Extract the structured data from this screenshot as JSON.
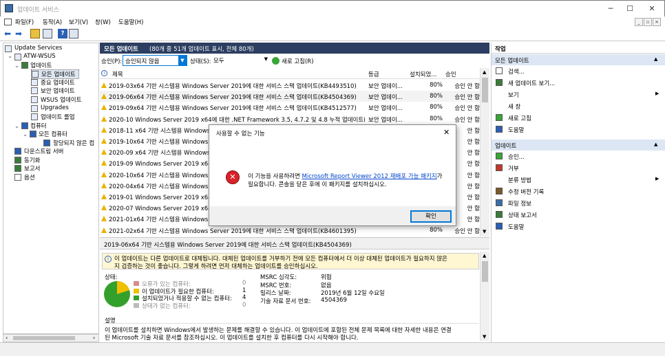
{
  "window": {
    "title": "업데이트 서비스",
    "min": "─",
    "max": "☐",
    "close": "✕",
    "mdi_min": "_",
    "mdi_restore": "▫",
    "mdi_close": "×"
  },
  "menu": [
    "파일(F)",
    "동작(A)",
    "보기(V)",
    "창(W)",
    "도움말(H)"
  ],
  "tree": {
    "root": "Update Services",
    "server": "ATW-WSUS",
    "updates": "업데이트",
    "children": [
      "모든 업데이트",
      "중요 업데이트",
      "보안 업데이트",
      "WSUS 업데이트",
      "Upgrades",
      "업데이트 롤업"
    ],
    "computers": "컴퓨터",
    "all_computers": "모든 컴퓨터",
    "unassigned": "할당되지 않은 컴",
    "downstream": "다운스트림 서버",
    "sync": "동기화",
    "reports": "보고서",
    "options": "옵션"
  },
  "header": {
    "title": "모든 업데이트",
    "count": "(80개 중 51개 업데이트 표시, 전체 80개)"
  },
  "filter": {
    "approval_label": "승인(P):",
    "approval_value": "승인되지 않음",
    "status_label": "상태(S):",
    "status_value": "모두",
    "refresh": "새로 고침(R)"
  },
  "columns": {
    "title": "제목",
    "class": "등급",
    "installed": "설치되었...",
    "approval": "승인"
  },
  "rows": [
    {
      "title": "2019-03x64 기반 시스템용 Windows Server 2019에 대한 서비스 스택 업데이트(KB4493510)",
      "class": "보안 업데이...",
      "pct": "80%",
      "approval": "승인 안 함"
    },
    {
      "title": "2019-06x64 기반 시스템용 Windows Server 2019에 대한 서비스 스택 업데이트(KB4504369)",
      "class": "보안 업데이...",
      "pct": "80%",
      "approval": "승인 안 함"
    },
    {
      "title": "2019-09x64 기반 시스템용 Windows Server 2019에 대한 서비스 스택 업데이트(KB4512577)",
      "class": "보안 업데이...",
      "pct": "80%",
      "approval": "승인 안 함"
    },
    {
      "title": "2020-10 Windows Server 2019 x64에 대한 .NET Framework 3.5, 4.7.2 및 4.8 누적 업데이트(KB...",
      "class": "보안 업데이...",
      "pct": "80%",
      "approval": "승인 안 함"
    },
    {
      "title": "2018-11 x64 기반 시스템용 Windows",
      "class": "",
      "pct": "",
      "approval": "안 함"
    },
    {
      "title": "2019-10x64 기반 시스템용 Windows S",
      "class": "",
      "pct": "",
      "approval": "안 함"
    },
    {
      "title": "2020-09 x64 기반 시스템용 Windows",
      "class": "",
      "pct": "",
      "approval": "안 함"
    },
    {
      "title": "2019-09 Windows Server 2019 x64에",
      "class": "",
      "pct": "",
      "approval": "안 함"
    },
    {
      "title": "2020-10x64 기반 시스템용 Windows S",
      "class": "",
      "pct": "",
      "approval": "안 함"
    },
    {
      "title": "2020-04x64 기반 시스템용 Windows S",
      "class": "",
      "pct": "",
      "approval": "안 함"
    },
    {
      "title": "2019-01 Windows Server 2019 x64에",
      "class": "",
      "pct": "",
      "approval": "안 함"
    },
    {
      "title": "2020-07 Windows Server 2019 x64에",
      "class": "",
      "pct": "",
      "approval": "안 함"
    },
    {
      "title": "2021-01x64 기반 시스템용 Windows S",
      "class": "",
      "pct": "",
      "approval": "안 함"
    },
    {
      "title": "2021-02x64 기반 시스템용 Windows Server 2019에 대한 서비스 스택 업데이트(KB4601395)",
      "class": "",
      "pct": "80%",
      "approval": "승인 안 함"
    }
  ],
  "detail": {
    "title": "2019-06x64 기반 시스템용 Windows Server 2019에 대한 서비스 스택 업데이트(KB4504369)",
    "info1": "이 업데이트는 다른 업데이트로 대체됩니다. 대체된 업데이트를 거부하기 전에 모든 컴퓨터에서 더 이상 대체된 업데이트가 필요하지 않은",
    "info2": "지 검증하는 것이 좋습니다. 그렇게 하려면 먼저 대체하는 업데이트를 승인하십시오.",
    "status_label": "상태:",
    "legend": [
      {
        "label": "오류가 있는 컴퓨터:",
        "value": "0",
        "color": "#d98c8c"
      },
      {
        "label": "이 업데이트가 필요한 컴퓨터:",
        "value": "1",
        "color": "#f0c000"
      },
      {
        "label": "설치되었거나 적용할 수 없는 컴퓨터:",
        "value": "4",
        "color": "#33a02c"
      },
      {
        "label": "상태가 없는 컴퓨터:",
        "value": "0",
        "color": "#bbbbbb"
      }
    ],
    "props": [
      {
        "k": "MSRC 심각도:",
        "v": "위험"
      },
      {
        "k": "MSRC 번호:",
        "v": "없음"
      },
      {
        "k": "릴리스 날짜:",
        "v": "2019년 6월 12일 수요일"
      },
      {
        "k": "기술 자료 문서 번호:",
        "v": "4504369"
      }
    ],
    "desc_label": "설명",
    "desc1": "이 업데이트를 설치하면 Windows에서 발생하는 문제를 해결할 수 있습니다. 이 업데이트에 포함된 전체 문제 목록에 대한 자세한 내용은 연결",
    "desc2": "된 Microsoft 기술 자료 문서를 참조하십시오. 이 업데이트를 설치한 후 컴퓨터를 다시 시작해야 합니다."
  },
  "actions": {
    "title": "작업",
    "section1": "모든 업데이트",
    "items1": [
      "검색...",
      "새 업데이트 보기...",
      "보기",
      "새 창",
      "새로 고침",
      "도움말"
    ],
    "section2": "업데이트",
    "items2": [
      "승인...",
      "거부",
      "분류 방법",
      "수정 버전 기록",
      "파일 정보",
      "상태 보고서",
      "도움말"
    ]
  },
  "dialog": {
    "title": "사용할 수 없는 기능",
    "text1": "이 기능을 사용하려면",
    "link": "Microsoft Report Viewer 2012 재배포 가능 패키지",
    "text1b": "가",
    "text2": "필요합니다. 콘솔을 닫은 후에 이 패키지를 설치하십시오.",
    "ok": "확인"
  },
  "pie": {
    "needed": 1,
    "installed": 4,
    "error": 0,
    "nostatus": 0
  }
}
